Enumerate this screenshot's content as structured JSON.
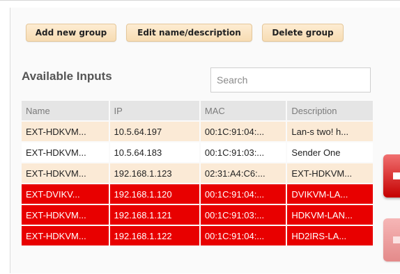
{
  "toolbar": {
    "add_group": "Add new group",
    "edit_group": "Edit name/description",
    "delete_group": "Delete group"
  },
  "inputs": {
    "title": "Available Inputs",
    "search_placeholder": "Search",
    "columns": [
      "Name",
      "IP",
      "MAC",
      "Description"
    ],
    "rows": [
      {
        "name": "EXT-HDKVM...",
        "ip": "10.5.64.197",
        "mac": "00:1C:91:04:...",
        "description": "Lan-s two! h...",
        "style": "beige"
      },
      {
        "name": "EXT-HDKVM...",
        "ip": "10.5.64.183",
        "mac": "00:1C:91:03:...",
        "description": "Sender One",
        "style": "white"
      },
      {
        "name": "EXT-HDKVM...",
        "ip": "192.168.1.123",
        "mac": "02:31:A4:C6:...",
        "description": "EXT-HDKVM...",
        "style": "beige"
      },
      {
        "name": "EXT-DVIKV...",
        "ip": "192.168.1.120",
        "mac": "00:1C:91:04:...",
        "description": "DVIKVM-LA...",
        "style": "red"
      },
      {
        "name": "EXT-HDKVM...",
        "ip": "192.168.1.121",
        "mac": "00:1C:91:03:...",
        "description": "HDKVM-LAN...",
        "style": "red"
      },
      {
        "name": "EXT-HDKVM...",
        "ip": "192.168.1.122",
        "mac": "00:1C:91:04:...",
        "description": "HD2IRS-LA...",
        "style": "red"
      }
    ]
  },
  "side_buttons": {
    "add_icon": "arrow-right-icon",
    "remove_icon": "arrow-left-icon"
  },
  "colors": {
    "button_bg": "#f7dcb3",
    "row_highlight": "#fbead6",
    "row_selected": "#e80000"
  }
}
